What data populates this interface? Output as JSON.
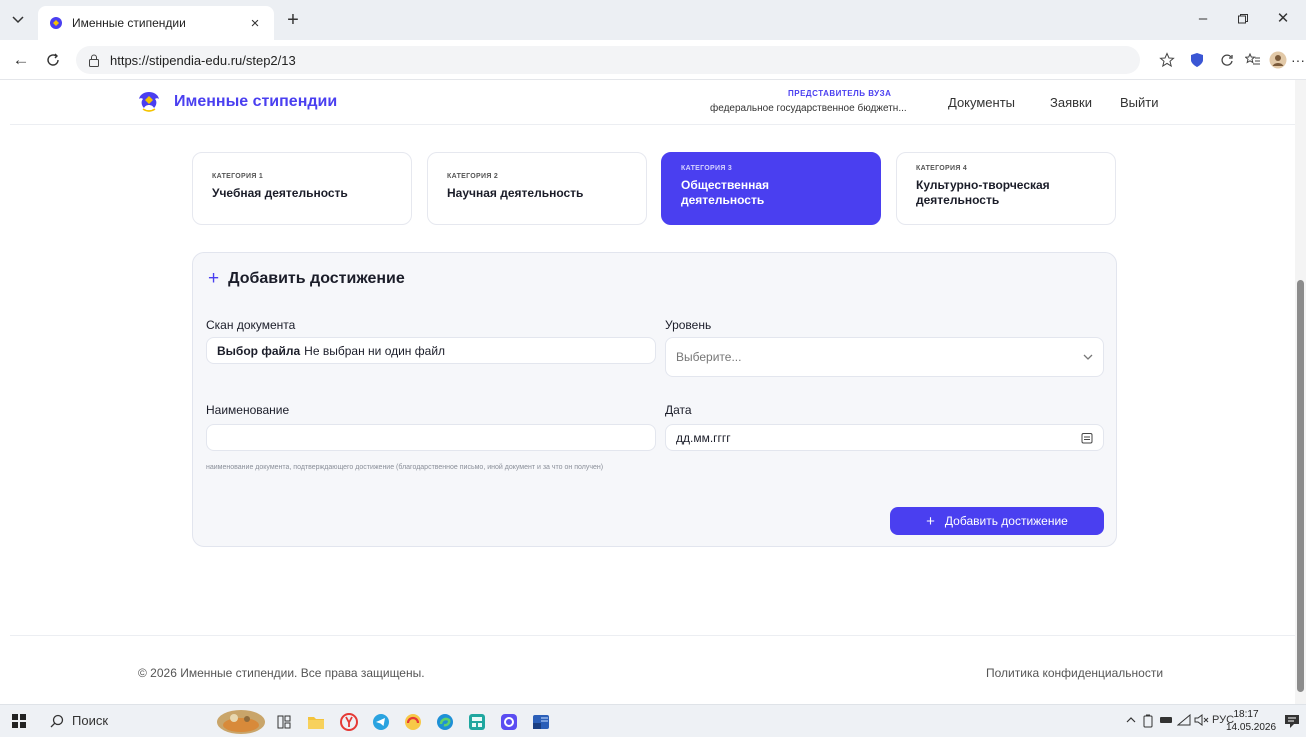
{
  "browser": {
    "tab_title": "Именные стипендии",
    "url": "https://stipendia-edu.ru/step2/13"
  },
  "header": {
    "site_title": "Именные стипендии",
    "rep_label": "ПРЕДСТАВИТЕЛЬ ВУЗА",
    "rep_org": "федеральное государственное бюджетн...",
    "nav": [
      "Документы",
      "Заявки",
      "Выйти"
    ]
  },
  "categories": [
    {
      "kicker": "КАТЕГОРИЯ 1",
      "name": "Учебная деятельность",
      "active": false
    },
    {
      "kicker": "КАТЕГОРИЯ 2",
      "name": "Научная деятельность",
      "active": false
    },
    {
      "kicker": "КАТЕГОРИЯ 3",
      "name": "Общественная деятельность",
      "active": true
    },
    {
      "kicker": "КАТЕГОРИЯ 4",
      "name": "Культурно-творческая деятельность",
      "active": false
    }
  ],
  "form": {
    "title": "Добавить достижение",
    "scan_label": "Скан документа",
    "file_button": "Выбор файла",
    "file_status": "Не выбран ни один файл",
    "level_label": "Уровень",
    "level_placeholder": "Выберите...",
    "name_label": "Наименование",
    "name_value": "",
    "name_hint": "наименование документа, подтверждающего достижение (благодарственное письмо, иной документ и за что он получен)",
    "date_label": "Дата",
    "date_placeholder": "дд.мм.гггг",
    "submit": "Добавить достижение"
  },
  "footer": {
    "copyright": "© 2026 Именные стипендии. Все права защищены.",
    "privacy": "Политика конфиденциальности"
  },
  "taskbar": {
    "search": "Поиск",
    "lang": "РУС",
    "time": "18:17",
    "date": "14.05.2026"
  },
  "colors": {
    "accent": "#4a3ff0",
    "text": "#1b1d29",
    "card_bg": "#f6f7fa"
  }
}
